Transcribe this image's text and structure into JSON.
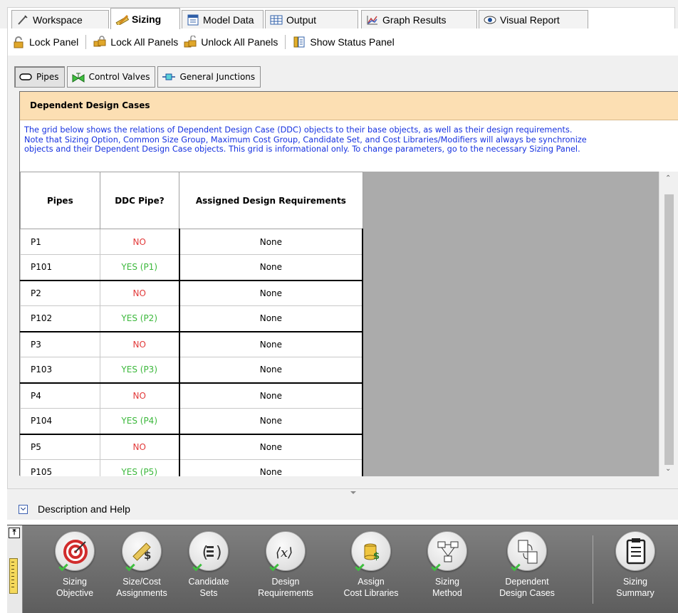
{
  "tabs": [
    {
      "label": "Workspace",
      "icon": "workspace-icon",
      "active": false
    },
    {
      "label": "Sizing",
      "icon": "ruler-pencil-icon",
      "active": true
    },
    {
      "label": "Model Data",
      "icon": "model-data-icon",
      "active": false
    },
    {
      "label": "Output",
      "icon": "output-table-icon",
      "active": false
    },
    {
      "label": "Graph Results",
      "icon": "graph-icon",
      "active": false
    },
    {
      "label": "Visual Report",
      "icon": "eye-icon",
      "active": false
    }
  ],
  "toolbar": {
    "lock_panel": "Lock Panel",
    "lock_all": "Lock All Panels",
    "unlock_all": "Unlock All Panels",
    "show_status": "Show Status Panel"
  },
  "subtabs": [
    {
      "label": "Pipes",
      "active": true
    },
    {
      "label": "Control Valves",
      "active": false
    },
    {
      "label": "General Junctions",
      "active": false
    }
  ],
  "ddc": {
    "title": "Dependent Design Cases",
    "desc_lines": [
      "The grid below shows the relations of Dependent Design Case (DDC) objects to their base objects, as well as their design requirements.",
      "Note that Sizing Option, Common Size Group, Maximum Cost Group, Candidate Set, and Cost Libraries/Modifiers will always be synchronize",
      "objects and their Dependent Design Case objects. This grid is informational only. To change parameters, go to the necessary Sizing Panel."
    ]
  },
  "grid": {
    "headers": [
      "Pipes",
      "DDC Pipe?",
      "Assigned Design Requirements"
    ],
    "rows": [
      {
        "pipe": "P1",
        "ddc": "NO",
        "req": "None"
      },
      {
        "pipe": "P101",
        "ddc": "YES (P1)",
        "req": "None"
      },
      {
        "pipe": "P2",
        "ddc": "NO",
        "req": "None"
      },
      {
        "pipe": "P102",
        "ddc": "YES (P2)",
        "req": "None"
      },
      {
        "pipe": "P3",
        "ddc": "NO",
        "req": "None"
      },
      {
        "pipe": "P103",
        "ddc": "YES (P3)",
        "req": "None"
      },
      {
        "pipe": "P4",
        "ddc": "NO",
        "req": "None"
      },
      {
        "pipe": "P104",
        "ddc": "YES (P4)",
        "req": "None"
      },
      {
        "pipe": "P5",
        "ddc": "NO",
        "req": "None"
      },
      {
        "pipe": "P105",
        "ddc": "YES (P5)",
        "req": "None"
      }
    ]
  },
  "description_help": "Description and Help",
  "nav": [
    {
      "line1": "Sizing",
      "line2": "Objective",
      "icon": "target-icon"
    },
    {
      "line1": "Size/Cost",
      "line2": "Assignments",
      "icon": "size-cost-icon"
    },
    {
      "line1": "Candidate",
      "line2": "Sets",
      "icon": "candidate-sets-icon"
    },
    {
      "line1": "Design",
      "line2": "Requirements",
      "icon": "design-requirements-icon"
    },
    {
      "line1": "Assign",
      "line2": "Cost Libraries",
      "icon": "cost-library-icon"
    },
    {
      "line1": "Sizing",
      "line2": "Method",
      "icon": "sizing-method-icon"
    },
    {
      "line1": "Dependent",
      "line2": "Design Cases",
      "icon": "dependent-design-icon"
    },
    {
      "line1": "Sizing",
      "line2": "Summary",
      "icon": "clipboard-icon"
    }
  ]
}
